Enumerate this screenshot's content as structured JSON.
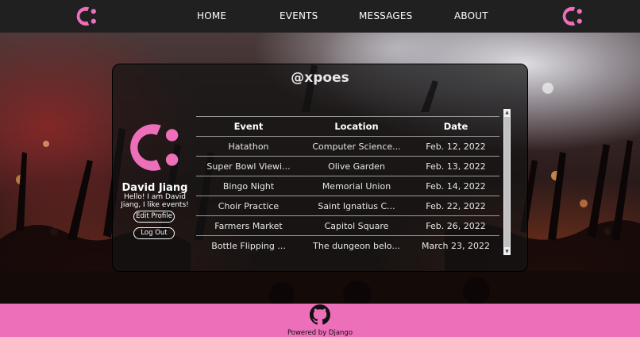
{
  "colors": {
    "brand_pink": "#ee6fb9",
    "navbar": "#202020",
    "footer": "#ee6fb9",
    "card_bg": "rgba(20,20,20,0.72)"
  },
  "navbar": {
    "left_logo_icon": "brand-c-icon",
    "right_logo_icon": "brand-c-icon",
    "links": [
      {
        "label": "HOME"
      },
      {
        "label": "EVENTS"
      },
      {
        "label": "MESSAGES"
      },
      {
        "label": "ABOUT"
      }
    ]
  },
  "profile": {
    "handle": "@xpoes",
    "avatar_icon": "brand-c-icon",
    "name": "David Jiang",
    "bio": "Hello! I am David Jiang, I like events!",
    "edit_button": "Edit Profile",
    "logout_button": "Log Out"
  },
  "events_table": {
    "headers": [
      "Event",
      "Location",
      "Date"
    ],
    "rows": [
      [
        "Hatathon",
        "Computer Science...",
        "Feb. 12, 2022"
      ],
      [
        "Super Bowl Viewi...",
        "Olive Garden",
        "Feb. 13, 2022"
      ],
      [
        "Bingo Night",
        "Memorial Union",
        "Feb. 14, 2022"
      ],
      [
        "Choir Practice",
        "Saint Ignatius C...",
        "Feb. 22, 2022"
      ],
      [
        "Farmers Market",
        "Capitol Square",
        "Feb. 26, 2022"
      ],
      [
        "Bottle Flipping ...",
        "The dungeon belo...",
        "March 23, 2022"
      ]
    ]
  },
  "footer": {
    "icon": "github-icon",
    "powered_by": "Powered by Django"
  }
}
